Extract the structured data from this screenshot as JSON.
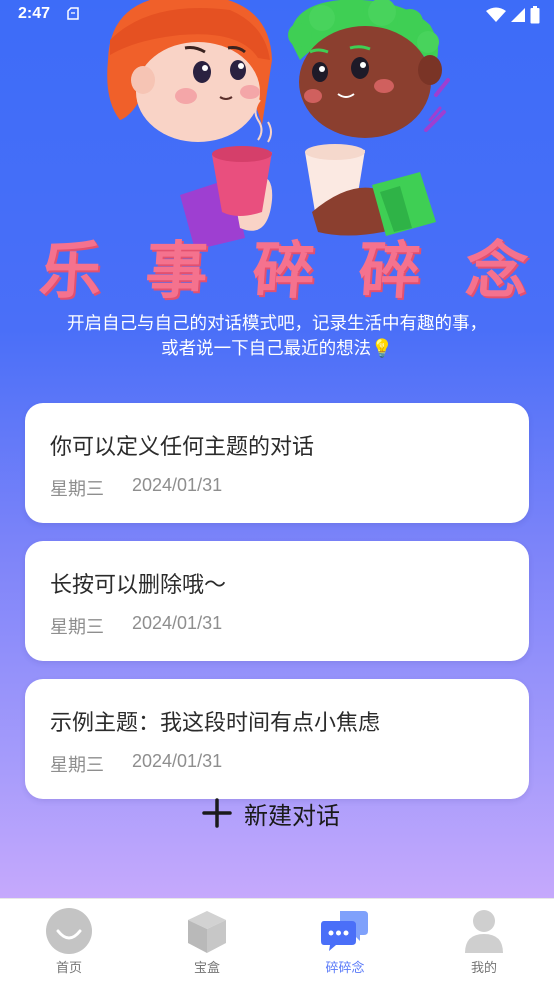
{
  "status_bar": {
    "time": "2:47"
  },
  "header": {
    "title_chars": [
      "乐",
      "事",
      "碎",
      "碎",
      "念"
    ],
    "intro": "开启自己与自己的对话模式吧，记录生活中有趣的事，或者说一下自己最近的想法💡"
  },
  "conversations": [
    {
      "title": "你可以定义任何主题的对话",
      "weekday": "星期三",
      "date": "2024/01/31"
    },
    {
      "title": "长按可以删除哦～",
      "weekday": "星期三",
      "date": "2024/01/31"
    },
    {
      "title": "示例主题：我这段时间有点小焦虑",
      "weekday": "星期三",
      "date": "2024/01/31"
    }
  ],
  "new_chat": {
    "label": "新建对话"
  },
  "bottom_nav": {
    "items": [
      {
        "label": "首页",
        "icon": "smile-face-icon",
        "active": false
      },
      {
        "label": "宝盒",
        "icon": "cube-box-icon",
        "active": false
      },
      {
        "label": "碎碎念",
        "icon": "chat-bubbles-icon",
        "active": true
      },
      {
        "label": "我的",
        "icon": "person-icon",
        "active": false
      }
    ]
  },
  "colors": {
    "accent": "#5a7af8",
    "title_pink": "#f5728e",
    "bg_top": "#3d6cf8",
    "bg_bottom": "#c6a9fc"
  }
}
